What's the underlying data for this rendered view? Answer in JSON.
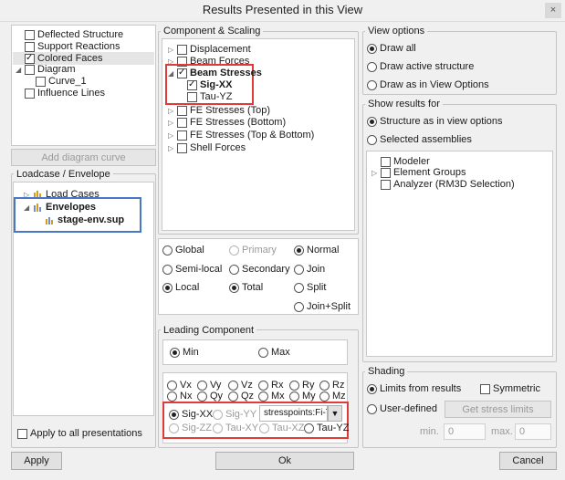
{
  "window": {
    "title": "Results Presented in this View",
    "close_glyph": "×"
  },
  "structure_tree": {
    "items": [
      {
        "label": "Deflected Structure",
        "checked": false
      },
      {
        "label": "Support Reactions",
        "checked": false
      },
      {
        "label": "Colored Faces",
        "checked": true
      },
      {
        "label": "Diagram",
        "checked": false
      },
      {
        "label": "Curve_1",
        "checked": false
      },
      {
        "label": "Influence Lines",
        "checked": false
      }
    ],
    "add_button": "Add diagram curve"
  },
  "loadcase": {
    "legend": "Loadcase / Envelope",
    "items": [
      {
        "label": "Load Cases"
      },
      {
        "label": "Envelopes"
      },
      {
        "label": "stage-env.sup"
      }
    ],
    "apply_all": "Apply to all presentations"
  },
  "component": {
    "legend": "Component & Scaling",
    "items": [
      {
        "label": "Displacement"
      },
      {
        "label": "Beam Forces"
      },
      {
        "label": "Beam Stresses"
      },
      {
        "label": "Sig-XX"
      },
      {
        "label": "Tau-YZ"
      },
      {
        "label": "FE Stresses (Top)"
      },
      {
        "label": "FE Stresses (Bottom)"
      },
      {
        "label": "FE Stresses (Top & Bottom)"
      },
      {
        "label": "Shell Forces"
      }
    ]
  },
  "coords": {
    "global": "Global",
    "primary": "Primary",
    "normal": "Normal",
    "semilocal": "Semi-local",
    "secondary": "Secondary",
    "join": "Join",
    "local": "Local",
    "total": "Total",
    "split": "Split",
    "joinsplit": "Join+Split"
  },
  "leading": {
    "legend": "Leading Component",
    "min": "Min",
    "max": "Max",
    "r1": [
      "Vx",
      "Vy",
      "Vz",
      "Rx",
      "Ry",
      "Rz"
    ],
    "r2": [
      "Nx",
      "Qy",
      "Qz",
      "Mx",
      "My",
      "Mz"
    ],
    "r3": [
      "Sig-XX",
      "Sig-YY"
    ],
    "r4": [
      "Sig-ZZ",
      "Tau-XY",
      "Tau-XZ",
      "Tau-YZ"
    ],
    "select_value": "stresspoints:Fi-T"
  },
  "view_options": {
    "legend": "View options",
    "draw_all": "Draw all",
    "draw_active": "Draw active structure",
    "draw_as": "Draw as in View Options"
  },
  "show_results": {
    "legend": "Show results for",
    "structure": "Structure as in view options",
    "selected": "Selected assemblies",
    "items": [
      {
        "label": "Modeler"
      },
      {
        "label": "Element Groups"
      },
      {
        "label": "Analyzer (RM3D Selection)"
      }
    ]
  },
  "shading": {
    "legend": "Shading",
    "limits": "Limits from results",
    "symmetric": "Symmetric",
    "user": "User-defined",
    "get_limits": "Get stress limits",
    "min_label": "min.",
    "min_val": "0",
    "max_label": "max.",
    "max_val": "0"
  },
  "footer": {
    "apply": "Apply",
    "ok": "Ok",
    "cancel": "Cancel"
  }
}
